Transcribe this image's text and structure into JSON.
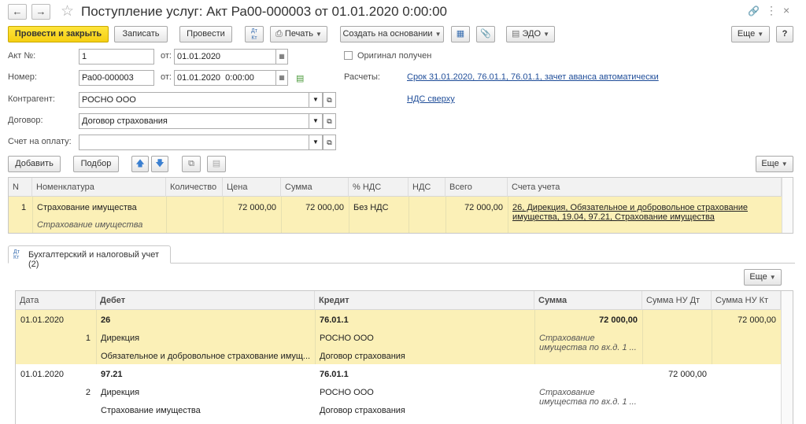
{
  "window": {
    "title": "Поступление услуг: Акт Ра00-000003 от 01.01.2020 0:00:00"
  },
  "toolbar": {
    "post_close": "Провести и закрыть",
    "save": "Записать",
    "post": "Провести",
    "print": "Печать",
    "create_based": "Создать на основании",
    "edo": "ЭДО",
    "more": "Еще",
    "help": "?"
  },
  "form": {
    "akt_label": "Акт №:",
    "akt_value": "1",
    "ot_label1": "от:",
    "akt_date": "01.01.2020",
    "original_label": "Оригинал получен",
    "nomer_label": "Номер:",
    "nomer_value": "Ра00-000003",
    "ot_label2": "от:",
    "nomer_date": "01.01.2020  0:00:00",
    "raschety_label": "Расчеты:",
    "raschety_link": "Срок 31.01.2020, 76.01.1, 76.01.1, зачет аванса автоматически",
    "kontragent_label": "Контрагент:",
    "kontragent_value": "РОСНО ООО",
    "nds_link": "НДС сверху",
    "dogovor_label": "Договор:",
    "dogovor_value": "Договор страхования",
    "schet_label": "Счет на оплату:",
    "schet_value": ""
  },
  "items_toolbar": {
    "add": "Добавить",
    "select": "Подбор",
    "more": "Еще"
  },
  "items_table": {
    "headers": [
      "N",
      "Номенклатура",
      "Количество",
      "Цена",
      "Сумма",
      "% НДС",
      "НДС",
      "Всего",
      "Счета учета"
    ],
    "row": {
      "n": "1",
      "nomenklatura": "Страхование имущества",
      "nomenklatura_sub": "Страхование имущества",
      "kolichestvo": "",
      "cena": "72 000,00",
      "summa": "72 000,00",
      "nds_rate": "Без НДС",
      "nds": "",
      "vsego": "72 000,00",
      "scheta_line1": "26, Дирекция, Обязательное и добровольное страхование",
      "scheta_line2": "имущества, 19.04, 97.21, Страхование имущества"
    }
  },
  "tab": {
    "icon": "Дт/Кт",
    "label": "Бухгалтерский и налоговый учет (2)"
  },
  "ledger": {
    "more": "Еще",
    "headers": [
      "Дата",
      "Дебет",
      "Кредит",
      "Сумма",
      "Сумма НУ Дт",
      "Сумма НУ Кт"
    ],
    "entries": [
      {
        "date": "01.01.2020",
        "num": "1",
        "debet_account": "26",
        "debet_sub1": "Дирекция",
        "debet_sub2": "Обязательное и добровольное страхование имущ...",
        "kredit_account": "76.01.1",
        "kredit_sub1": "РОСНО ООО",
        "kredit_sub2": "Договор страхования",
        "summa": "72 000,00",
        "content_line1": "Страхование",
        "content_line2": "имущества по вх.д. 1 ...",
        "nu_dt": "",
        "nu_kt": "72 000,00"
      },
      {
        "date": "01.01.2020",
        "num": "2",
        "debet_account": "97.21",
        "debet_sub1": "Дирекция",
        "debet_sub2": "Страхование имущества",
        "kredit_account": "76.01.1",
        "kredit_sub1": "РОСНО ООО",
        "kredit_sub2": "Договор страхования",
        "summa": "",
        "content_line1": "Страхование",
        "content_line2": "имущества по вх.д. 1 ...",
        "nu_dt": "72 000,00",
        "nu_kt": ""
      }
    ]
  }
}
